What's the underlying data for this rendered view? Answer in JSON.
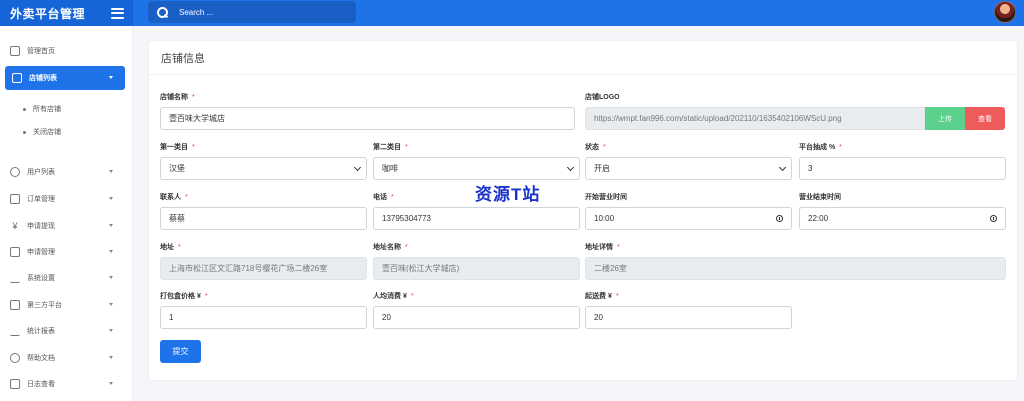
{
  "app": {
    "title": "外卖平台管理"
  },
  "search": {
    "placeholder": "Search ..."
  },
  "sidebar": {
    "items": [
      {
        "label": "管理首页"
      },
      {
        "label": "店铺列表"
      },
      {
        "label": "用户列表"
      },
      {
        "label": "订单管理"
      },
      {
        "label": "申请提现"
      },
      {
        "label": "申请管理"
      },
      {
        "label": "系统设置"
      },
      {
        "label": "第三方平台"
      },
      {
        "label": "统计报表"
      },
      {
        "label": "帮助文档"
      },
      {
        "label": "日志查看"
      }
    ],
    "sub_items": [
      {
        "label": "所有店铺"
      },
      {
        "label": "关闭店铺"
      }
    ]
  },
  "card": {
    "title": "店铺信息"
  },
  "form": {
    "shop_name": {
      "label": "店铺名称",
      "value": "壹百味大学城店"
    },
    "logo": {
      "label": "店铺LOGO",
      "value": "https://wmpt.fan996.com/static/upload/202110/1635402106WScU.png",
      "upload": "上传",
      "view": "查看"
    },
    "cat1": {
      "label": "第一类目",
      "value": "汉堡"
    },
    "cat2": {
      "label": "第二类目",
      "value": "咖啡"
    },
    "status": {
      "label": "状态",
      "value": "开启"
    },
    "commission": {
      "label": "平台抽成 %",
      "value": "3"
    },
    "contact": {
      "label": "联系人",
      "value": "蔡蔡"
    },
    "phone": {
      "label": "电话",
      "value": "13795304773"
    },
    "open_time": {
      "label": "开始营业时间",
      "value": "10:00"
    },
    "close_time": {
      "label": "营业结束时间",
      "value": "22:00"
    },
    "address": {
      "label": "地址",
      "value": "上海市松江区文汇路718号樱花广场二楼26室"
    },
    "address_name": {
      "label": "地址名称",
      "value": "壹百味(松江大学城店)"
    },
    "address_detail": {
      "label": "地址详情",
      "value": "二楼26室"
    },
    "pack_price": {
      "label": "打包盒价格 ¥",
      "value": "1"
    },
    "avg_spend": {
      "label": "人均消费 ¥",
      "value": "20"
    },
    "min_order": {
      "label": "起送费 ¥",
      "value": "20"
    },
    "submit": "提交"
  },
  "watermark": "资源T站"
}
